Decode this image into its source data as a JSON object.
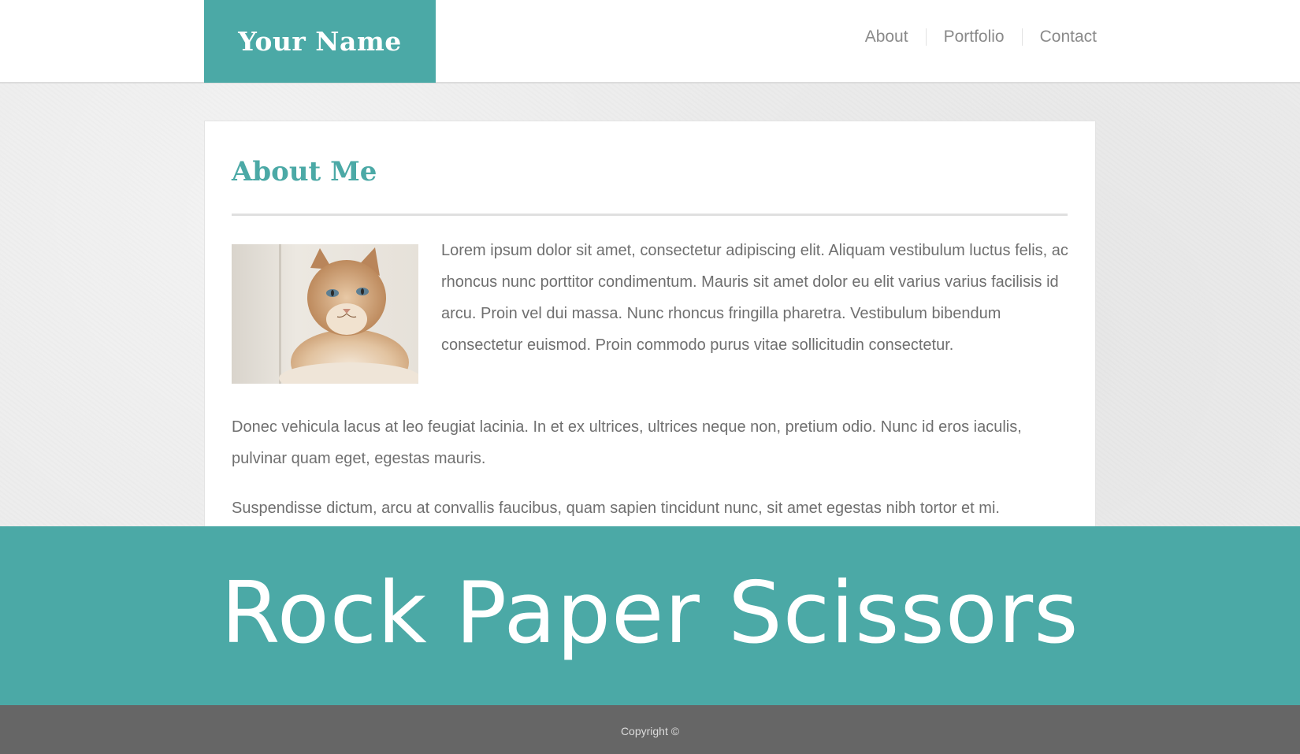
{
  "header": {
    "logo": "Your Name",
    "nav": [
      "About",
      "Portfolio",
      "Contact"
    ]
  },
  "content": {
    "title": "About Me",
    "paragraph_1": "Lorem ipsum dolor sit amet, consectetur adipiscing elit. Aliquam vestibulum luctus felis, ac rhoncus nunc porttitor condimentum. Mauris sit amet dolor eu elit varius varius facilisis id arcu. Proin vel dui massa. Nunc rhoncus fringilla pharetra. Vestibulum bibendum consectetur euismod. Proin commodo purus vitae sollicitudin consectetur.",
    "paragraph_2": "Donec vehicula lacus at leo feugiat lacinia. In et ex ultrices, ultrices neque non, pretium odio. Nunc id eros iaculis, pulvinar quam eget, egestas mauris.",
    "paragraph_3": "Suspendisse dictum, arcu at convallis faucibus, quam sapien tincidunt nunc, sit amet egestas nibh tortor et mi."
  },
  "banner": {
    "text": "Rock Paper Scissors"
  },
  "footer": {
    "text": "Copyright ©"
  },
  "colors": {
    "accent": "#4ba9a6",
    "footer_bg": "#666666",
    "page_bg": "#ececec",
    "body_text": "#6f6f6f"
  },
  "icons": {
    "photo": "cat-photo"
  }
}
